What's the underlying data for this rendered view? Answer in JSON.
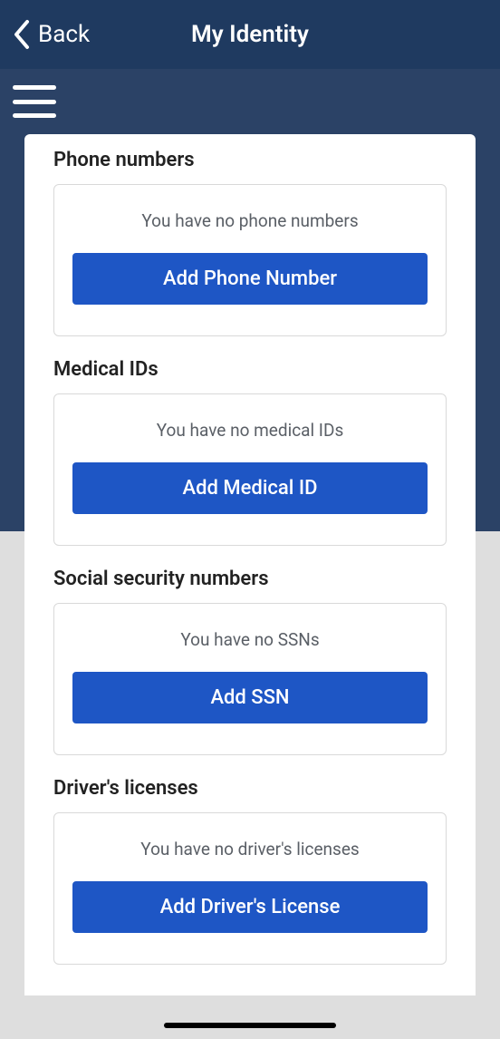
{
  "nav": {
    "back_label": "Back",
    "title": "My Identity"
  },
  "sections": {
    "phone": {
      "title": "Phone numbers",
      "empty": "You have no phone numbers",
      "button": "Add Phone Number"
    },
    "medical": {
      "title": "Medical IDs",
      "empty": "You have no medical IDs",
      "button": "Add Medical ID"
    },
    "ssn": {
      "title": "Social security numbers",
      "empty": "You have no SSNs",
      "button": "Add SSN"
    },
    "license": {
      "title": "Driver's licenses",
      "empty": "You have no driver's licenses",
      "button": "Add Driver's License"
    }
  }
}
